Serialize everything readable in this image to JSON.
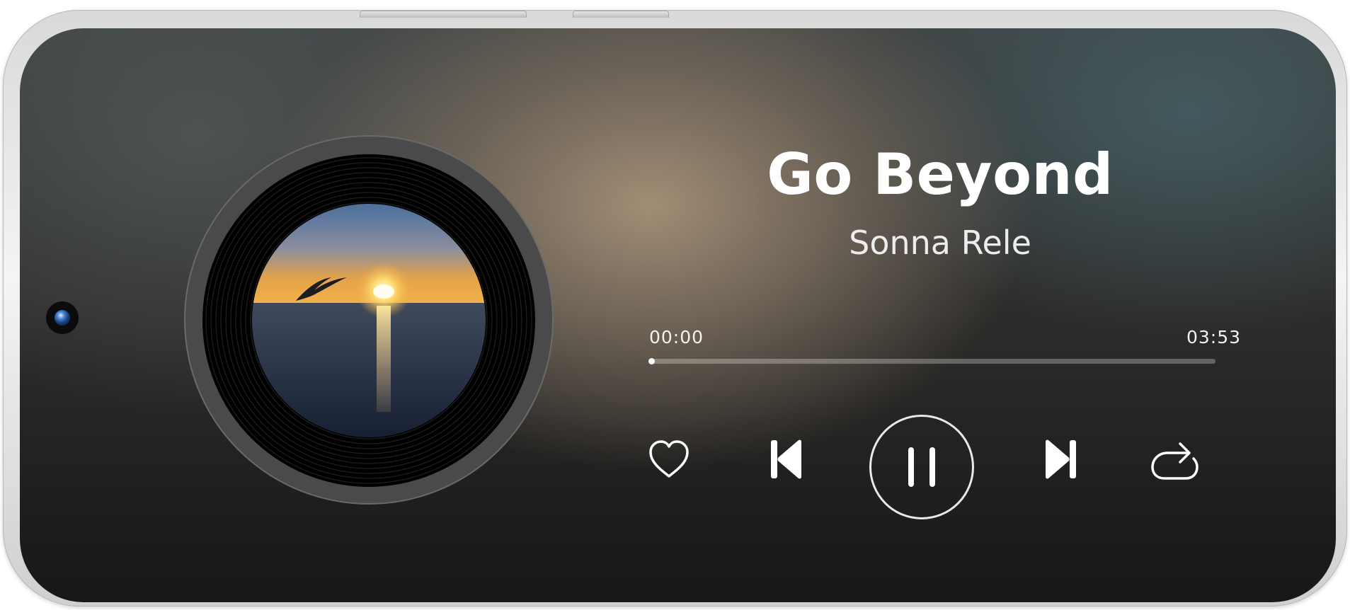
{
  "player": {
    "title": "Go Beyond",
    "artist": "Sonna Rele",
    "elapsed": "00:00",
    "duration": "03:53",
    "progress_fraction": 0.002,
    "cover_art_description": "",
    "controls": {
      "like": "heart-icon",
      "previous": "skip-previous-icon",
      "play_pause": "pause-icon",
      "next": "skip-next-icon",
      "repeat": "repeat-icon"
    }
  },
  "colors": {
    "text_primary": "#ffffff",
    "accent": "#ffffff"
  }
}
